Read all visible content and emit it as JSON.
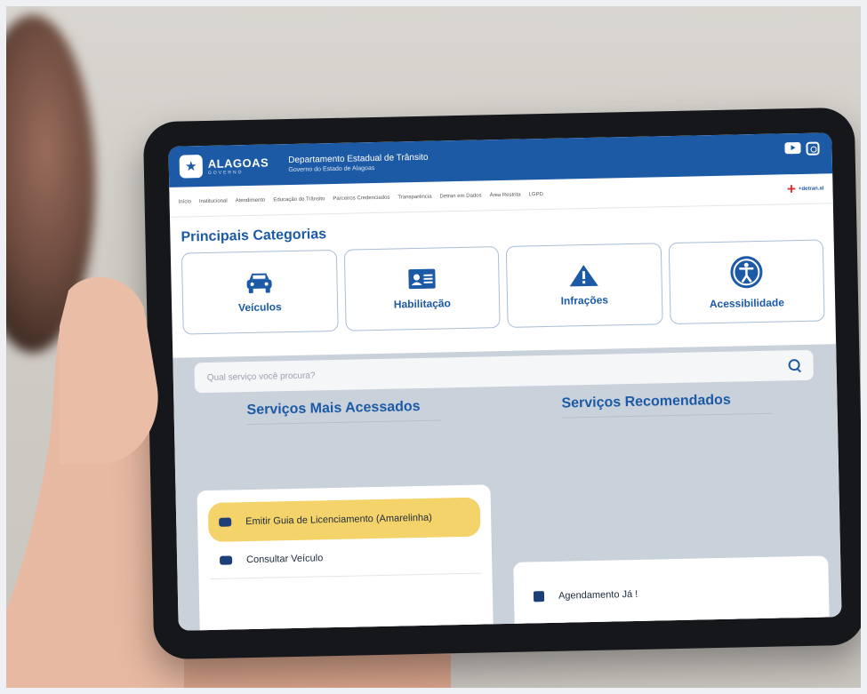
{
  "header": {
    "logo_text": "ALAGOAS",
    "logo_sub": "GOVERNO",
    "agency_title": "Departamento Estadual de Trânsito",
    "agency_subtitle": "Governo do Estado de Alagoas"
  },
  "nav": {
    "items": [
      "Início",
      "Institucional",
      "Atendimento",
      "Educação de Trânsito",
      "Parceiros Credenciados",
      "Transparência",
      "Detran em Dados",
      "Área Restrita",
      "LGPD"
    ],
    "plus_label": "+detran.al"
  },
  "main": {
    "section_title": "Principais Categorias",
    "categories": [
      {
        "label": "Veículos",
        "icon": "car-icon"
      },
      {
        "label": "Habilitação",
        "icon": "id-card-icon"
      },
      {
        "label": "Infrações",
        "icon": "warning-icon"
      },
      {
        "label": "Acessibilidade",
        "icon": "accessibility-icon"
      }
    ],
    "search_placeholder": "Qual serviço você procura?",
    "most_accessed_title": "Serviços Mais Acessados",
    "recommended_title": "Serviços Recomendados",
    "most_accessed": [
      {
        "label": "Emitir Guia de Licenciamento (Amarelinha)",
        "icon": "car-icon"
      },
      {
        "label": "Consultar Veículo",
        "icon": "car-icon"
      }
    ],
    "recommended": [
      {
        "label": "Agendamento Já !",
        "icon": "calendar-icon"
      }
    ]
  },
  "colors": {
    "brand_blue": "#1c5aa6",
    "highlight_yellow": "#f4d46a",
    "plus_red": "#e02b2b"
  }
}
